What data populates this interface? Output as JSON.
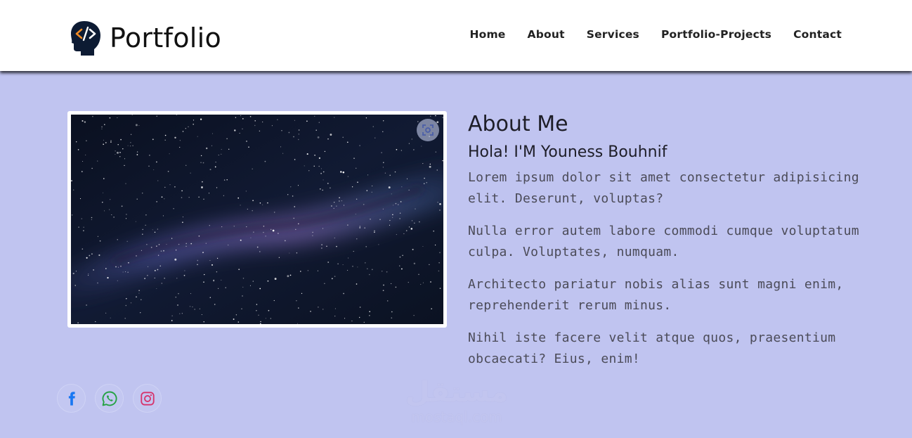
{
  "navbar": {
    "brand": {
      "logo_icon": "head-code-icon",
      "title": "Portfolio"
    },
    "links": [
      "Home",
      "About",
      "Services",
      "Portfolio-Projects",
      "Contact"
    ]
  },
  "hero_image": {
    "subject": "milky-way-night-sky",
    "lens_icon": "visual-search-icon"
  },
  "about": {
    "title": "About Me",
    "subtitle": "Hola! I'M Youness Bouhnif",
    "paragraphs": [
      "Lorem ipsum dolor sit amet consectetur adipisicing elit. Deserunt, voluptas?",
      "Nulla error autem labore commodi cumque voluptatum culpa. Voluptates, numquam.",
      "Architecto pariatur nobis alias sunt magni enim, reprehenderit rerum minus.",
      "Nihil iste facere velit atque quos, praesentium obcaecati? Eius, enim!"
    ]
  },
  "socials": [
    {
      "icon": "facebook-icon",
      "color": "#1877f2"
    },
    {
      "icon": "whatsapp-icon",
      "color": "#25a244"
    },
    {
      "icon": "instagram-icon",
      "color": "#d6336c"
    }
  ],
  "watermark": {
    "arabic": "مستقل",
    "latin": "mostaql.com"
  },
  "colors": {
    "page_bg": "#c0c4f0",
    "nav_bg": "#ffffff",
    "logo_dark": "#0d1b33",
    "logo_accent": "#f08a24"
  }
}
